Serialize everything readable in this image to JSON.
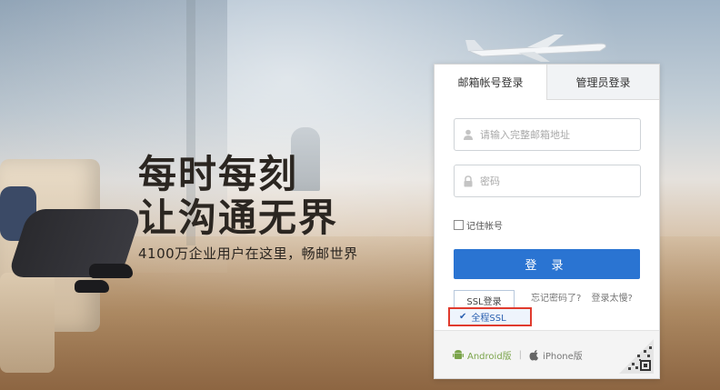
{
  "slogan": {
    "line1": "每时每刻",
    "line2": "让沟通无界",
    "subtitle": "4100万企业用户在这里，畅邮世界"
  },
  "login": {
    "tabs": [
      {
        "label": "邮箱帐号登录",
        "active": true
      },
      {
        "label": "管理员登录",
        "active": false
      }
    ],
    "email_placeholder": "请输入完整邮箱地址",
    "password_placeholder": "密码",
    "remember_label": "记住帐号",
    "login_button": "登 录",
    "ssl_select": "SSL登录",
    "ssl_option": "全程SSL",
    "forgot_password": "忘记密码了?",
    "slow_login": "登录太慢?",
    "footer": {
      "android_label": "Android版",
      "separator": "|",
      "iphone_label": "iPhone版"
    }
  },
  "colors": {
    "login_button": "#2a74d2",
    "highlight_border": "#e03b2e",
    "android_green": "#7aa44a"
  },
  "icons": [
    "user-icon",
    "lock-icon",
    "android-icon",
    "apple-icon",
    "qr-code-icon",
    "checkmark-icon"
  ]
}
